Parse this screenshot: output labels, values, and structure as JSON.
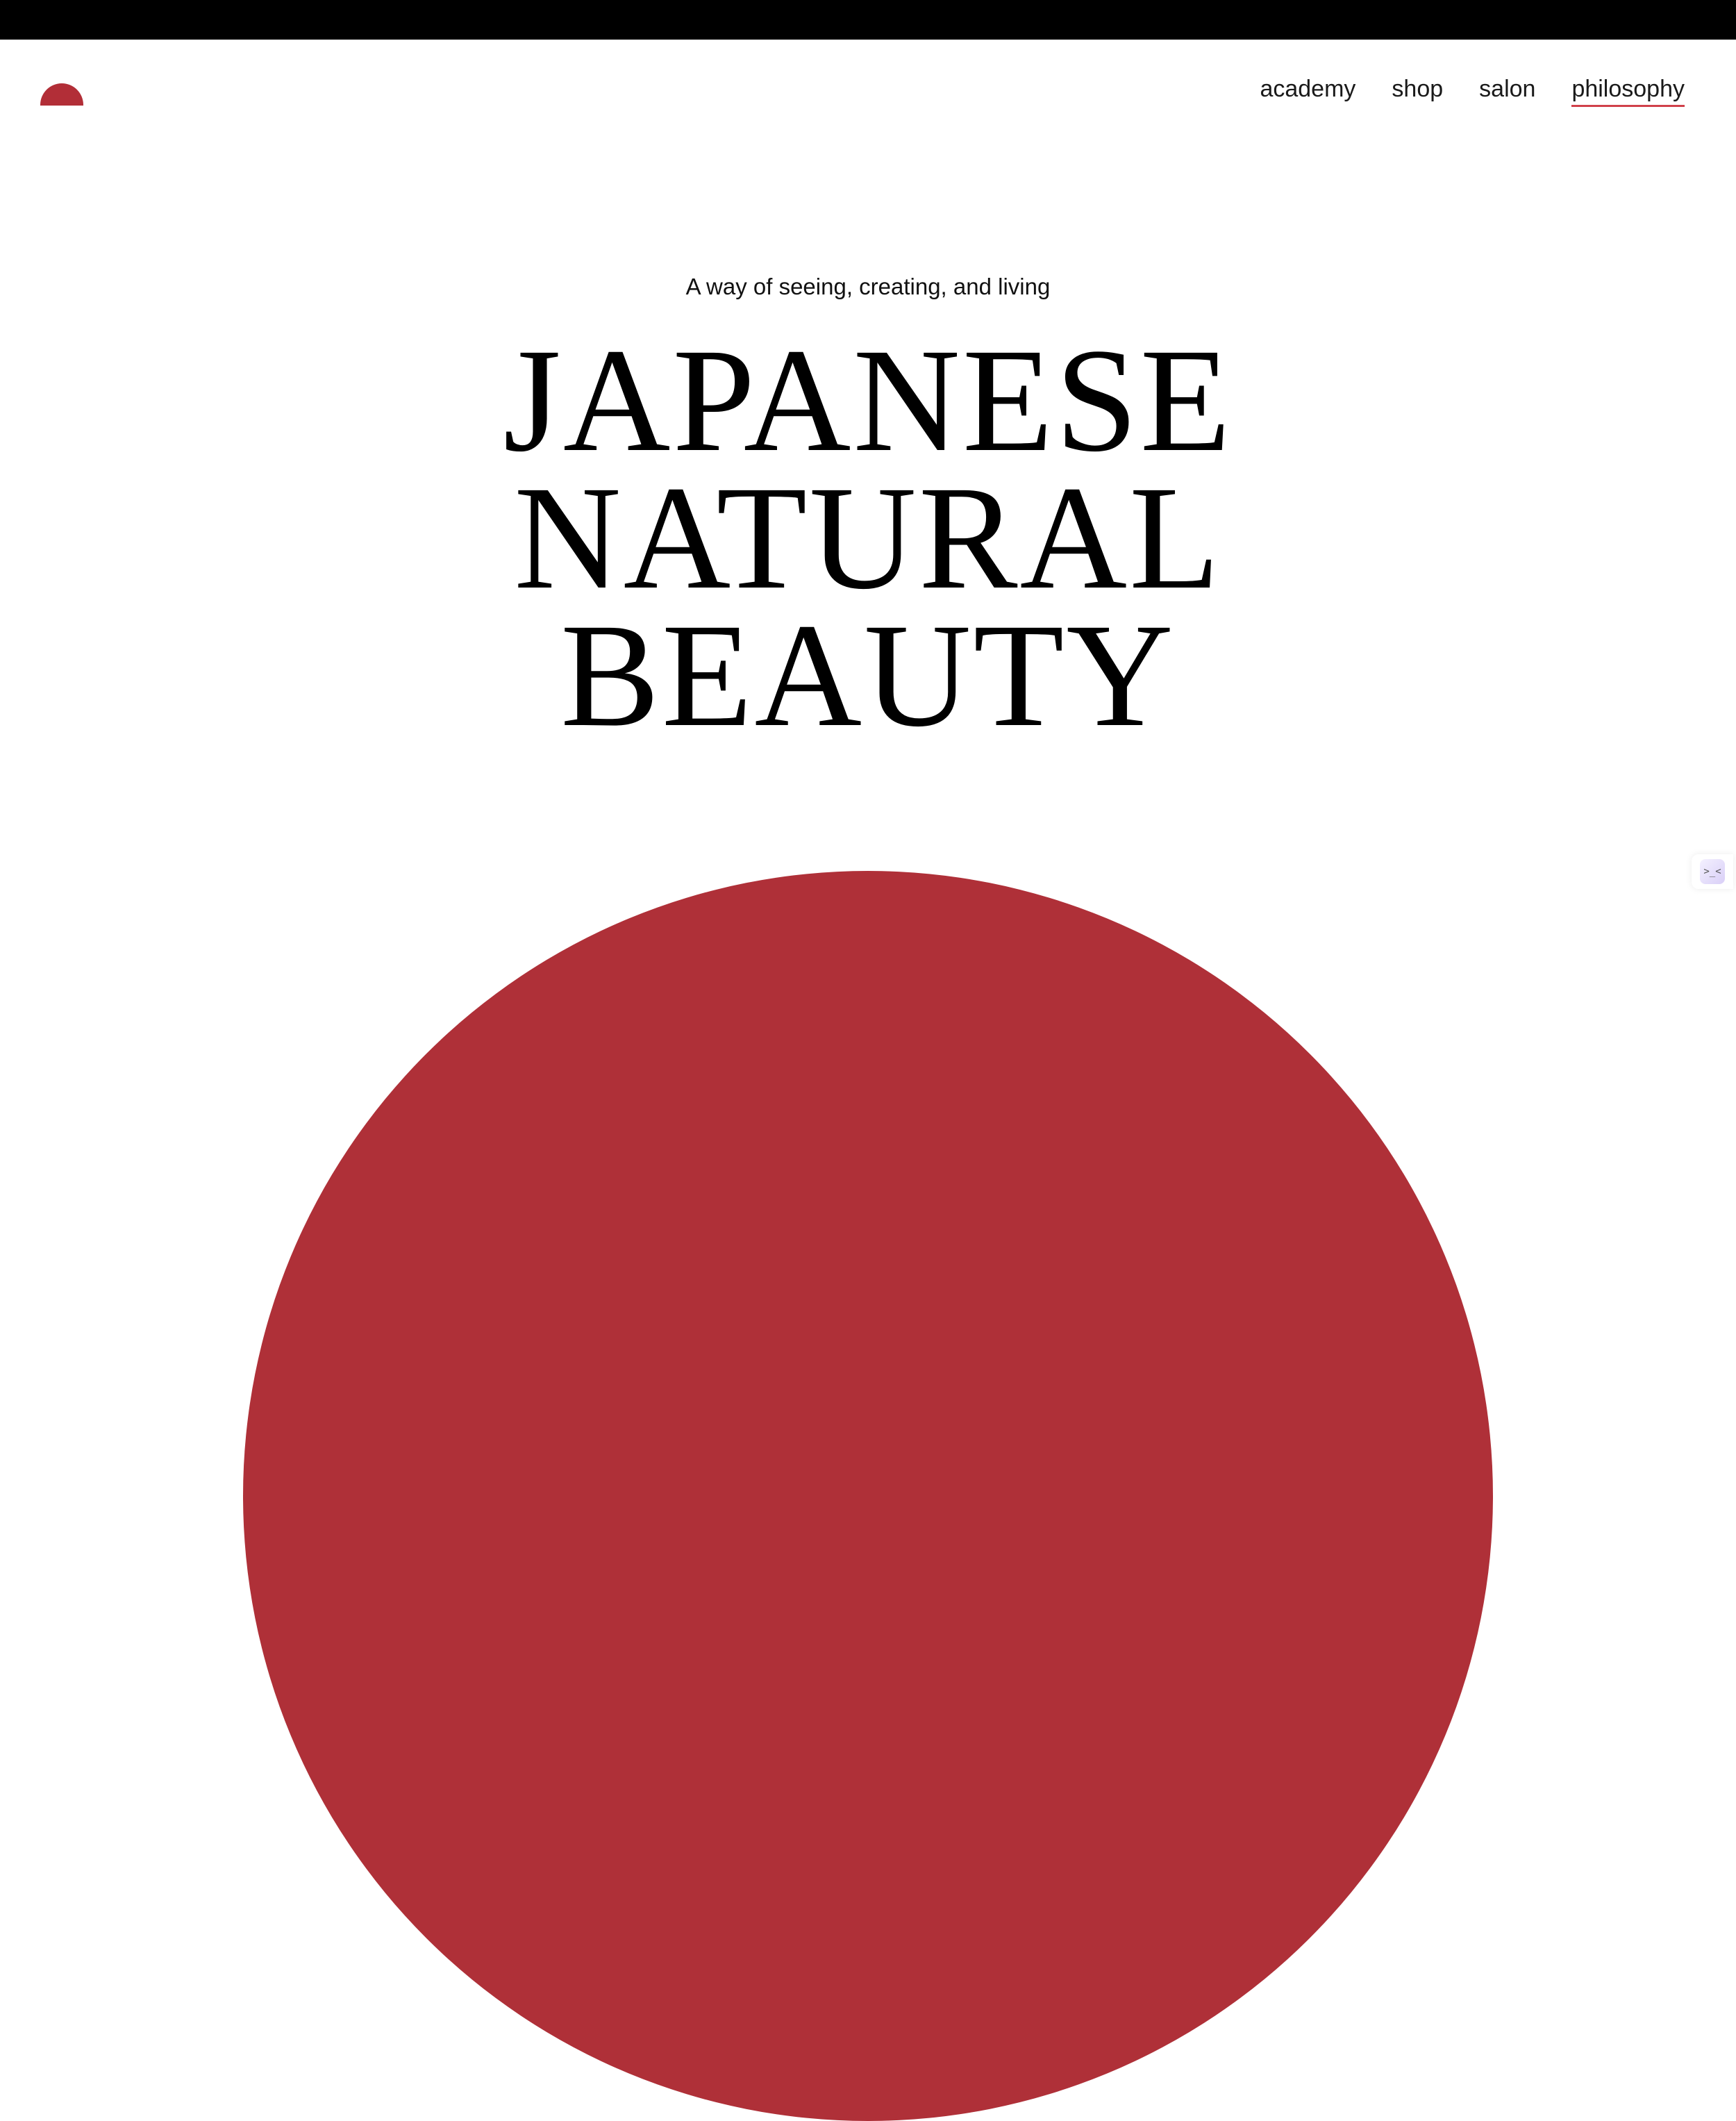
{
  "nav": {
    "items": [
      {
        "label": "academy"
      },
      {
        "label": "shop"
      },
      {
        "label": "salon"
      },
      {
        "label": "philosophy",
        "active": true
      }
    ]
  },
  "hero": {
    "tagline": "A way of seeing, creating, and living",
    "headline_lines": [
      "JAPANESE",
      "NATURAL",
      "BEAUTY"
    ]
  },
  "widget": {
    "glyph": ">_<"
  },
  "colors": {
    "brand_red": "#b22e37",
    "sun_red": "#af3038",
    "active_underline": "#d0404a",
    "top_bar": "#000000"
  },
  "icons": {
    "logo": "rising-sun-logo-icon",
    "widget": "assistant-widget-icon"
  }
}
